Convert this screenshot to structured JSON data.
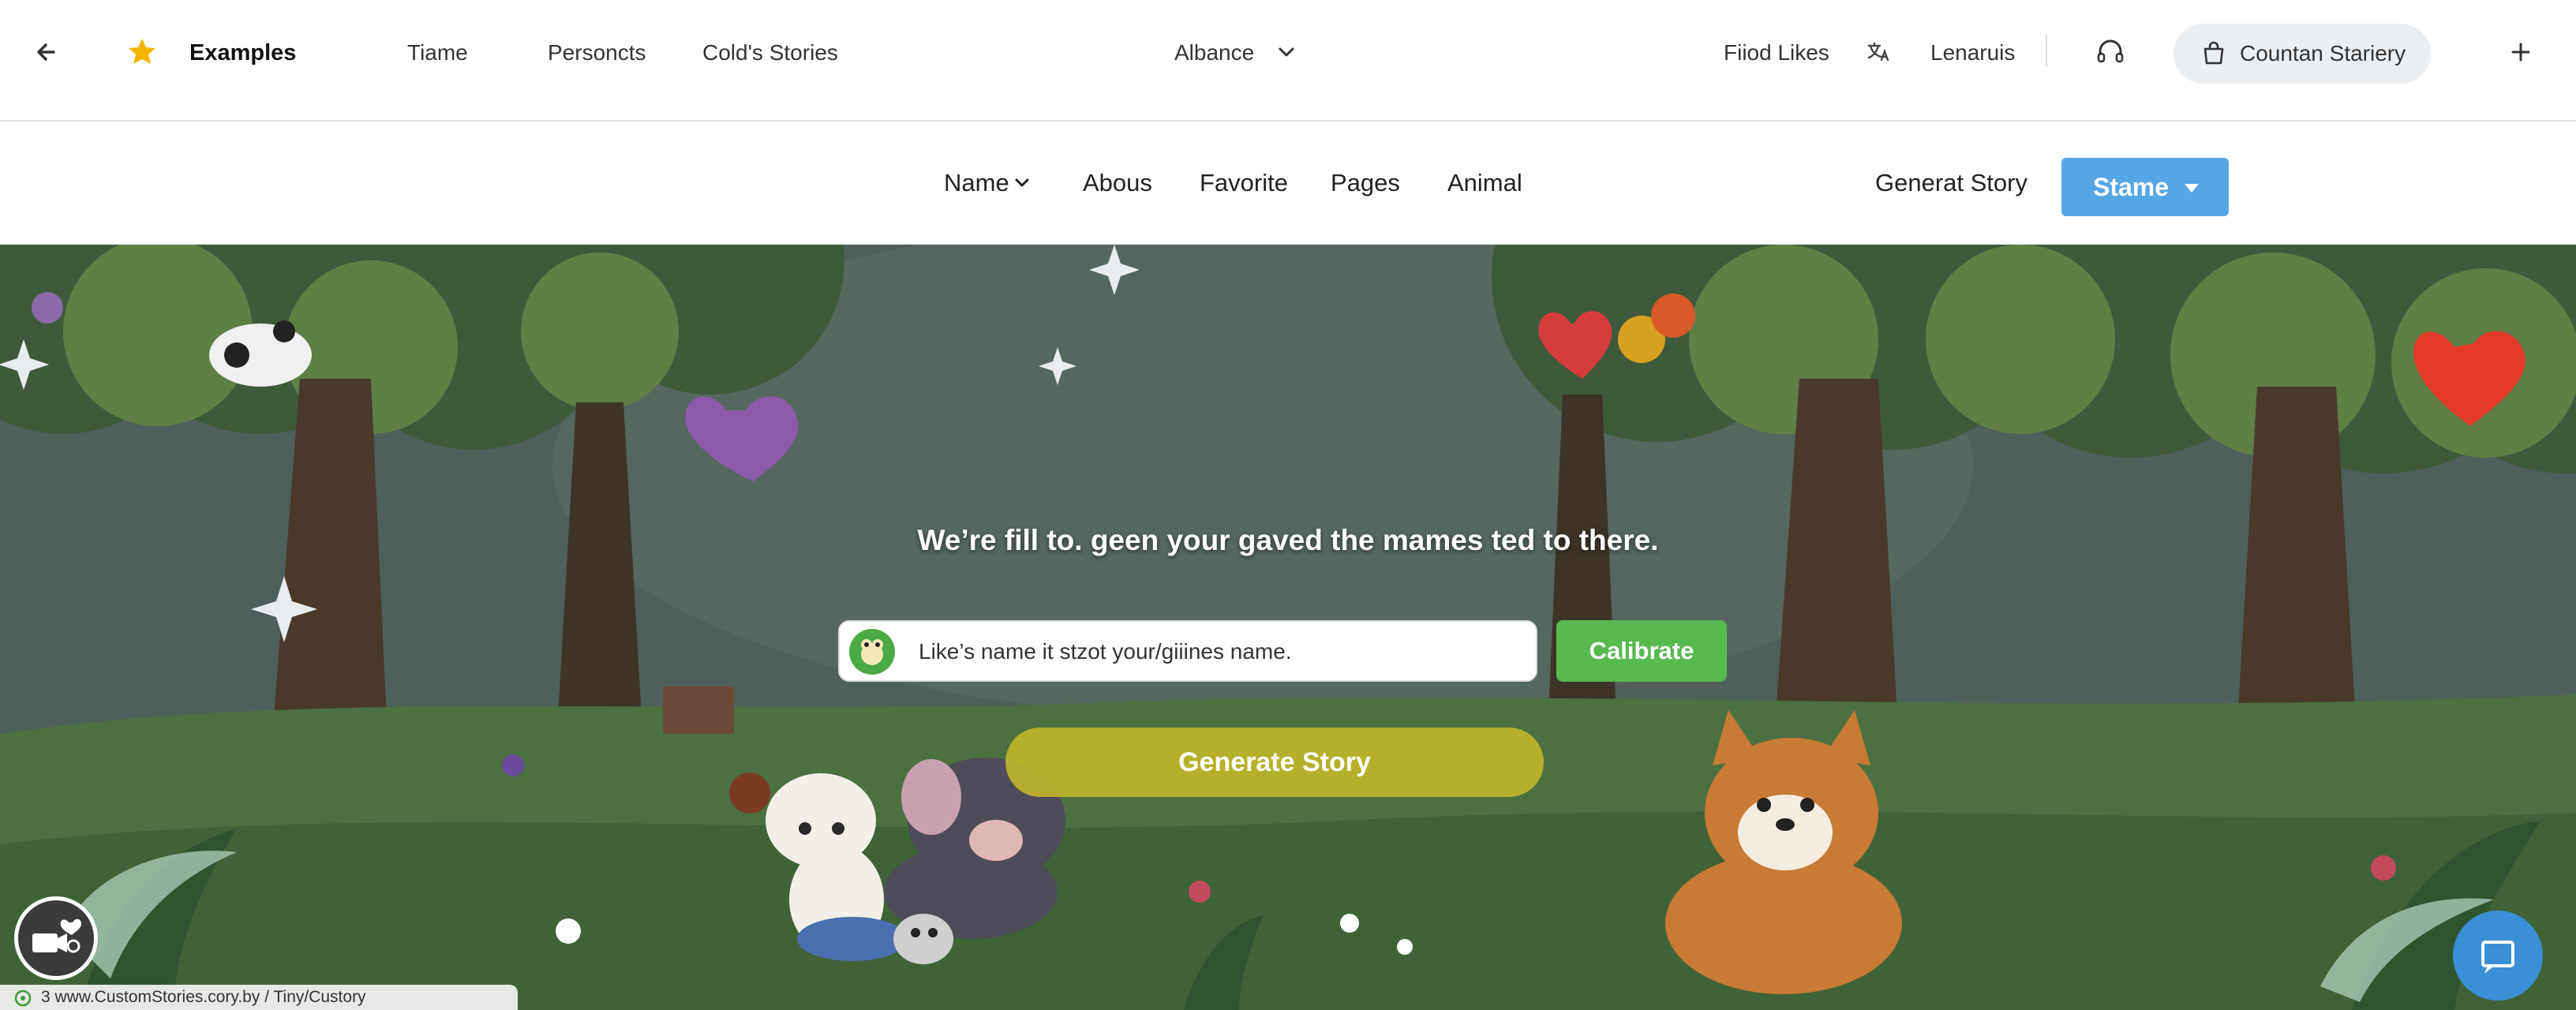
{
  "topbar": {
    "back_icon": "arrow-left-icon",
    "star_icon": "star-icon",
    "title": "Examples",
    "tabs": [
      {
        "label": "Tiame"
      },
      {
        "label": "Personcts"
      },
      {
        "label": "Cold's Stories"
      }
    ],
    "dropdown_label": "Albance",
    "find_likes": "Fiiod Likes",
    "translate_icon": "translate-icon",
    "user_label": "Lenaruis",
    "support_icon": "headset-icon",
    "account_button": "Countan Stariery",
    "bag_icon": "bag-icon",
    "add_icon": "plus-icon"
  },
  "nav": {
    "items": [
      {
        "label": "Name"
      },
      {
        "label": "Abous"
      },
      {
        "label": "Favorite"
      },
      {
        "label": "Pages"
      },
      {
        "label": "Animal"
      }
    ],
    "generate_link": "Generat Story",
    "stame_button": "Stame"
  },
  "hero": {
    "headline": "We’re fill to. geen your gaved the mames ted to there.",
    "search_placeholder": "Like’s name it stzot your/giiines name.",
    "calibrate_button": "Calibrate",
    "generate_button": "Generate Story"
  },
  "status_bar": {
    "url": "3 www.CustomStories.cory.by / Tiny/Custory"
  },
  "colors": {
    "primary_blue": "#56a6e5",
    "calibrate_green": "#57b94f",
    "generate_gold": "#c4b828",
    "chat_blue": "#3a8fd6"
  }
}
